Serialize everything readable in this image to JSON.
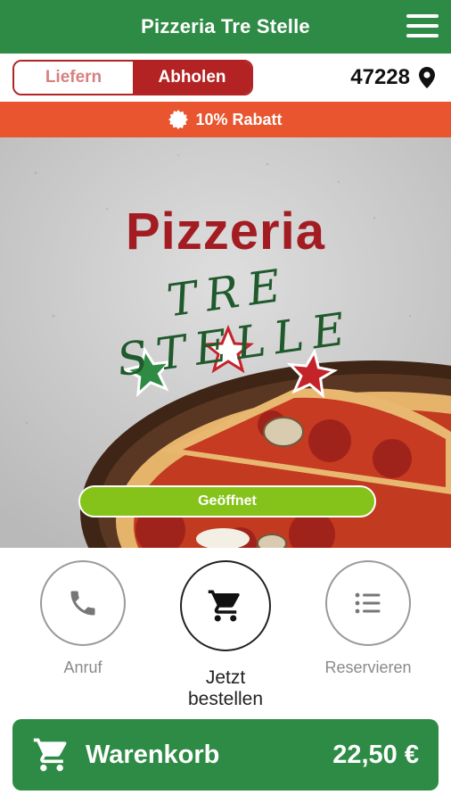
{
  "header": {
    "title": "Pizzeria Tre Stelle",
    "menu_icon": "menu-icon"
  },
  "mode": {
    "options": [
      "Liefern",
      "Abholen"
    ],
    "selected": "Abholen"
  },
  "location": {
    "zip": "47228",
    "icon": "location-pin-icon"
  },
  "promo": {
    "text": "10% Rabatt",
    "icon": "badge-icon"
  },
  "hero": {
    "logo_line1": "Pizzeria",
    "logo_line2": "TRE STELLE",
    "status": "Geöffnet"
  },
  "actions": [
    {
      "label": "Anruf",
      "icon": "phone-icon"
    },
    {
      "label": "Jetzt bestellen",
      "icon": "cart-icon"
    },
    {
      "label": "Reservieren",
      "icon": "list-icon"
    }
  ],
  "cart": {
    "label": "Warenkorb",
    "total": "22,50 €",
    "icon": "cart-icon"
  },
  "colors": {
    "primary_green": "#2e8b45",
    "brand_red": "#b32323",
    "promo_orange": "#e8552e",
    "status_green": "#86c31a"
  }
}
